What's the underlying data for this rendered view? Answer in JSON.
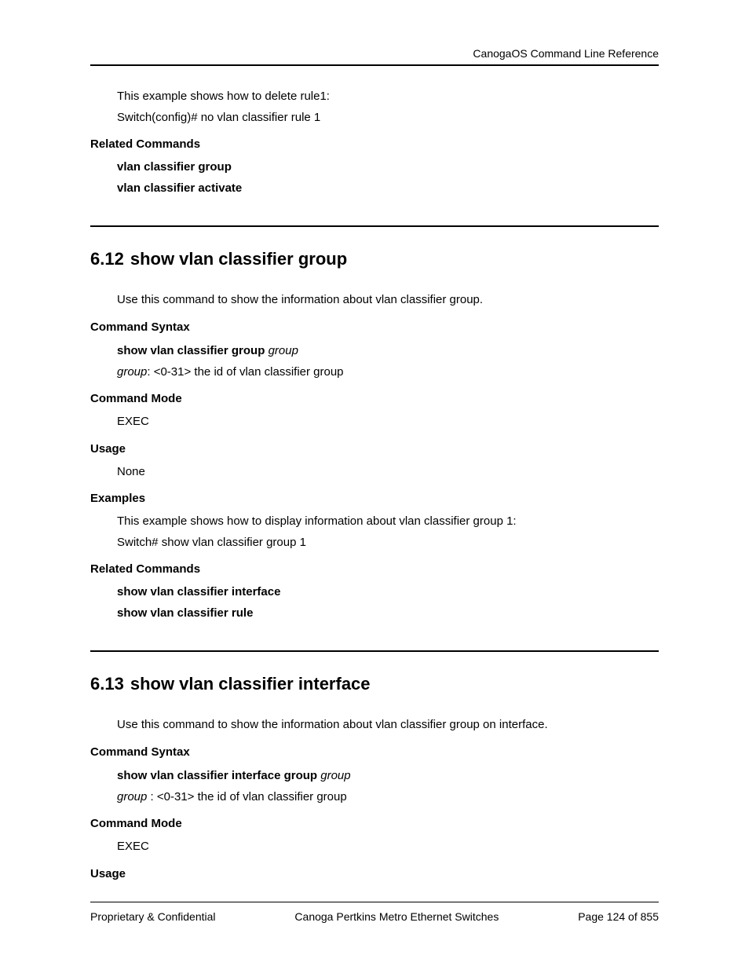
{
  "header": {
    "title": "CanogaOS Command Line Reference"
  },
  "top": {
    "example_line1": "This example shows how to delete rule1:",
    "example_line2": "Switch(config)# no vlan classifier rule 1",
    "related_heading": "Related Commands",
    "related1": "vlan classifier group",
    "related2": "vlan classifier activate"
  },
  "sec612": {
    "num": "6.12",
    "title": "show vlan classifier group",
    "desc": "Use this command to show the information about vlan classifier group.",
    "syntax_heading": "Command Syntax",
    "syntax_cmd": "show vlan classifier group ",
    "syntax_param": "group",
    "syntax_desc_param": "group",
    "syntax_desc_rest": ": <0-31> the id of vlan classifier group",
    "mode_heading": "Command Mode",
    "mode_value": "EXEC",
    "usage_heading": "Usage",
    "usage_value": "None",
    "examples_heading": "Examples",
    "example_line1": "This example shows how to display information about vlan classifier group 1:",
    "example_line2": "Switch# show vlan classifier group 1",
    "related_heading": "Related Commands",
    "related1": "show vlan classifier interface",
    "related2": "show vlan classifier rule"
  },
  "sec613": {
    "num": "6.13",
    "title": "show vlan classifier interface",
    "desc": "Use this command to show the information about vlan classifier group on interface.",
    "syntax_heading": "Command Syntax",
    "syntax_cmd": "show vlan classifier interface group ",
    "syntax_param": "group",
    "syntax_desc_param": "group ",
    "syntax_desc_rest": ": <0-31> the id of vlan classifier group",
    "mode_heading": "Command Mode",
    "mode_value": "EXEC",
    "usage_heading": "Usage"
  },
  "footer": {
    "left": "Proprietary & Confidential",
    "center": "Canoga Pertkins Metro Ethernet Switches",
    "right": "Page 124 of 855"
  }
}
